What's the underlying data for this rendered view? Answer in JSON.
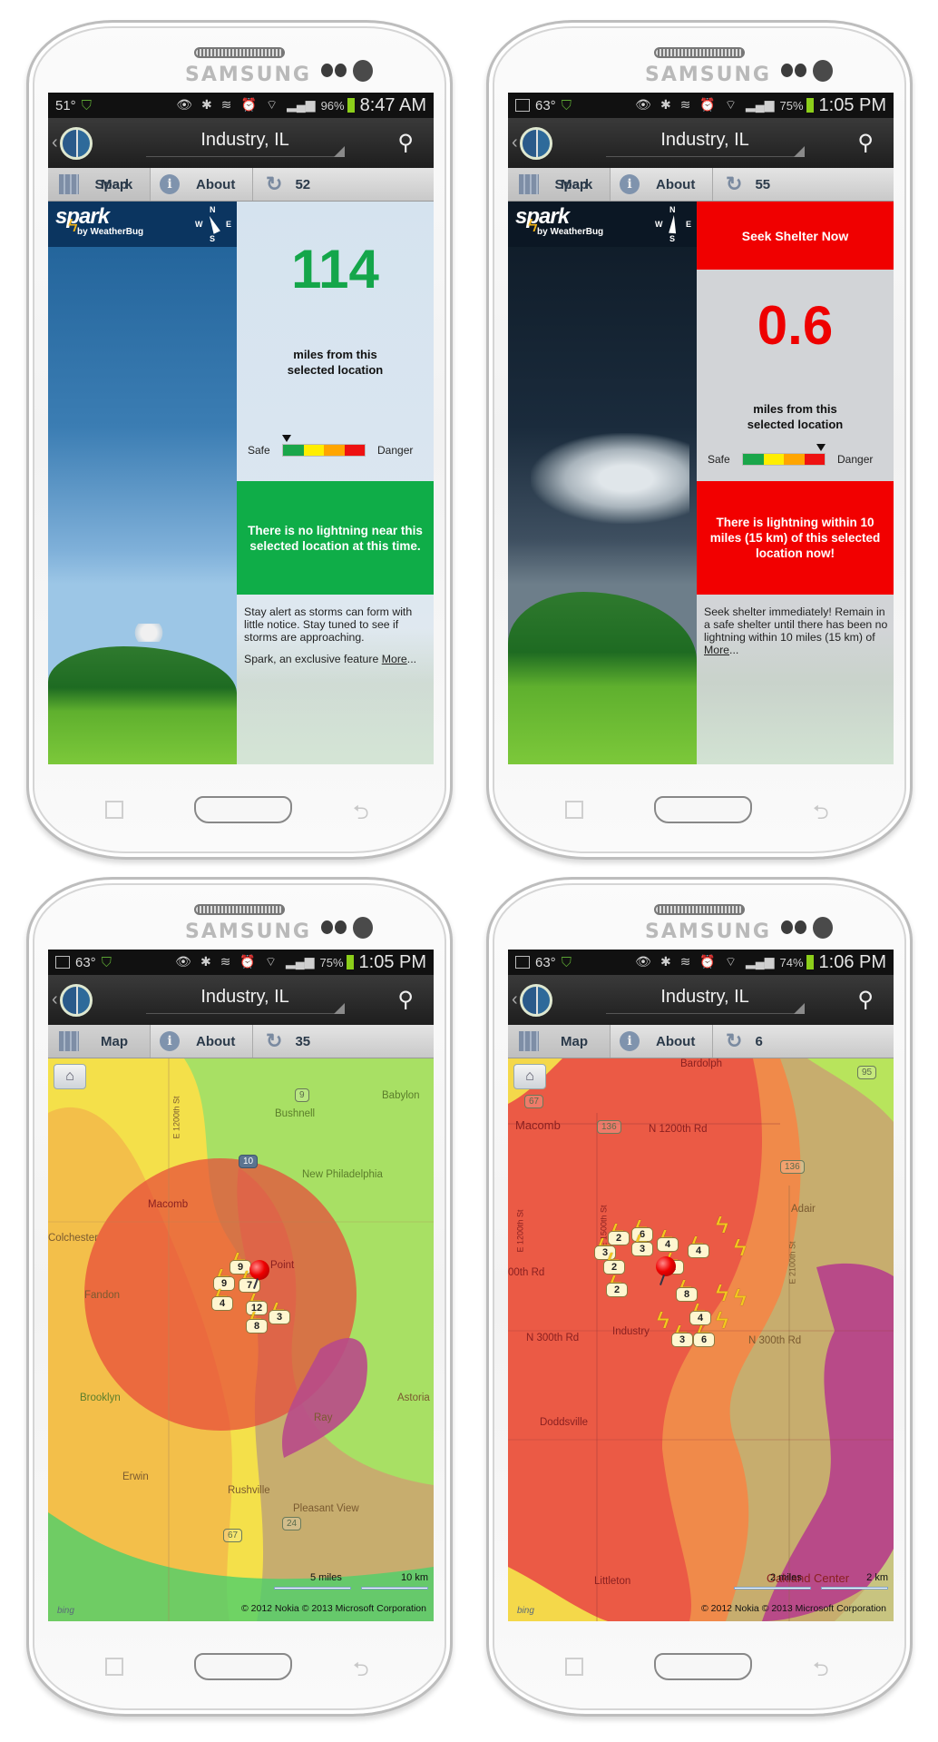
{
  "device_brand": "SAMSUNG",
  "phones": [
    {
      "status": {
        "temp": "51°",
        "battery_pct": "96%",
        "time": "8:47 AM",
        "show_gallery_icon": false
      },
      "title": {
        "location": "Industry, IL"
      },
      "tabs": {
        "spark": "Spark",
        "map": "Map",
        "about": "About",
        "refresh_count": "52",
        "active": "spark"
      },
      "spark": {
        "logo": "spark",
        "logo_sub": "by WeatherBug",
        "compass": {
          "n": "N",
          "w": "W",
          "e": "E",
          "s": "S"
        },
        "distance": "114",
        "distance_caption_1": "miles from this",
        "distance_caption_2": "selected location",
        "meter": {
          "safe_label": "Safe",
          "danger_label": "Danger",
          "level_fraction": 0.0,
          "colors": [
            "#1aa64a",
            "#ffee00",
            "#ffa500",
            "#ee1111"
          ]
        },
        "alert": "There is no lightning near this selected location at this time.",
        "alert_color": "#0fad48",
        "description": "Stay alert as storms can form with little notice. Stay tuned to see if storms are approaching.",
        "footer_text": "Spark, an exclusive feature ",
        "more_link": "More",
        "more_suffix": "..."
      }
    },
    {
      "status": {
        "temp": "63°",
        "battery_pct": "75%",
        "time": "1:05 PM",
        "show_gallery_icon": true
      },
      "title": {
        "location": "Industry, IL"
      },
      "tabs": {
        "spark": "Spark",
        "map": "Map",
        "about": "About",
        "refresh_count": "55",
        "active": "spark"
      },
      "spark": {
        "logo": "spark",
        "logo_sub": "by WeatherBug",
        "compass": {
          "n": "N",
          "w": "W",
          "e": "E",
          "s": "S"
        },
        "banner": "Seek Shelter Now",
        "distance": "0.6",
        "distance_caption_1": "miles from this",
        "distance_caption_2": "selected location",
        "meter": {
          "safe_label": "Safe",
          "danger_label": "Danger",
          "level_fraction": 1.0,
          "colors": [
            "#1aa64a",
            "#ffee00",
            "#ffa500",
            "#ee1111"
          ]
        },
        "alert": "There is lightning within 10 miles (15 km) of this selected location now!",
        "alert_color": "#f20000",
        "description": "Seek shelter immediately! Remain in a safe shelter until there has been no lightning within 10 miles (15 km) of ",
        "more_link": "More",
        "more_suffix": "..."
      }
    },
    {
      "status": {
        "temp": "63°",
        "battery_pct": "75%",
        "time": "1:05 PM",
        "show_gallery_icon": true
      },
      "title": {
        "location": "Industry, IL"
      },
      "tabs": {
        "spark": "Spark",
        "map": "Map",
        "about": "About",
        "refresh_count": "35",
        "active": "map"
      },
      "map": {
        "labels": [
          "Babylon",
          "Bushnell",
          "New Philadelphia",
          "Macomb",
          "Colchester",
          "Fandon",
          "Brooklyn",
          "Astoria",
          "Ray",
          "Erwin",
          "Rushville",
          "Pleasant View",
          "E 1200th St",
          "Point"
        ],
        "route_signs": [
          "9",
          "10",
          "67",
          "24"
        ],
        "strike_counts": [
          "9",
          "9",
          "7",
          "4",
          "12",
          "3",
          "8"
        ],
        "scale_miles": "5 miles",
        "scale_km": "10 km",
        "copyright": "© 2012 Nokia    © 2013 Microsoft Corporation",
        "provider": "bing"
      }
    },
    {
      "status": {
        "temp": "63°",
        "battery_pct": "74%",
        "time": "1:06 PM",
        "show_gallery_icon": true
      },
      "title": {
        "location": "Industry, IL"
      },
      "tabs": {
        "spark": "Spark",
        "map": "Map",
        "about": "About",
        "refresh_count": "6",
        "active": "map"
      },
      "map": {
        "labels": [
          "Bardolph",
          "Macomb",
          "N 1200th Rd",
          "Adair",
          "E 1200th St",
          "E 1500th St",
          "E 2100th St",
          "00th Rd",
          "N 300th Rd",
          "N 300th Rd",
          "Industry",
          "Doddsville",
          "Littleton",
          "Oakland Center"
        ],
        "route_signs": [
          "95",
          "67",
          "136",
          "136"
        ],
        "strike_counts": [
          "2",
          "6",
          "4",
          "3",
          "3",
          "4",
          "2",
          "2",
          "2",
          "8",
          "4",
          "3",
          "6"
        ],
        "scale_miles": "2 miles",
        "scale_km": "2 km",
        "copyright": "© 2012 Nokia    © 2013 Microsoft Corporation",
        "provider": "bing"
      }
    }
  ]
}
